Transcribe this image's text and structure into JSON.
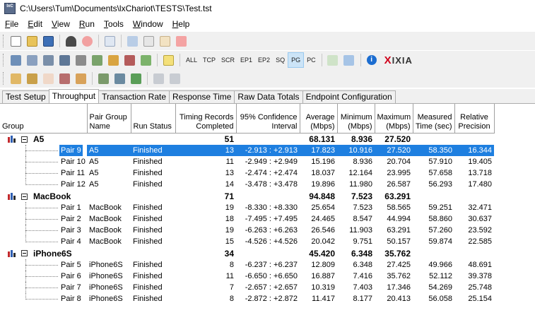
{
  "window": {
    "title": "C:\\Users\\Tum\\Documents\\lxChariot\\TESTS\\Test.tst",
    "icon_text": "IxC"
  },
  "menu": [
    {
      "label": "File",
      "key": "F"
    },
    {
      "label": "Edit",
      "key": "E"
    },
    {
      "label": "View",
      "key": "V"
    },
    {
      "label": "Run",
      "key": "R"
    },
    {
      "label": "Tools",
      "key": "T"
    },
    {
      "label": "Window",
      "key": "W"
    },
    {
      "label": "Help",
      "key": "H"
    }
  ],
  "toolbar2_text": [
    "ALL",
    "TCP",
    "SCR",
    "EP1",
    "EP2",
    "SQ",
    "PG",
    "PC"
  ],
  "toolbar2_active": "PG",
  "brand": {
    "text": "IXIA",
    "x_letter": "X"
  },
  "tabs": [
    "Test Setup",
    "Throughput",
    "Transaction Rate",
    "Response Time",
    "Raw Data Totals",
    "Endpoint Configuration"
  ],
  "active_tab": "Throughput",
  "columns": [
    {
      "label": "Group"
    },
    {
      "label": "Pair Group Name"
    },
    {
      "label": "Run Status"
    },
    {
      "label": "Timing Records Completed"
    },
    {
      "label": "95% Confidence Interval"
    },
    {
      "label": "Average (Mbps)"
    },
    {
      "label": "Minimum (Mbps)"
    },
    {
      "label": "Maximum (Mbps)"
    },
    {
      "label": "Measured Time (sec)"
    },
    {
      "label": "Relative Precision"
    }
  ],
  "groups": [
    {
      "name": "A5",
      "records": "51",
      "average": "68.131",
      "minimum": "8.936",
      "maximum": "27.520",
      "pairs": [
        {
          "pair": "Pair 9",
          "group": "A5",
          "status": "Finished",
          "records": "13",
          "ci": "-2.913 : +2.913",
          "avg": "17.823",
          "min": "10.916",
          "max": "27.520",
          "time": "58.350",
          "rp": "16.344",
          "selected": true
        },
        {
          "pair": "Pair 10",
          "group": "A5",
          "status": "Finished",
          "records": "11",
          "ci": "-2.949 : +2.949",
          "avg": "15.196",
          "min": "8.936",
          "max": "20.704",
          "time": "57.910",
          "rp": "19.405"
        },
        {
          "pair": "Pair 11",
          "group": "A5",
          "status": "Finished",
          "records": "13",
          "ci": "-2.474 : +2.474",
          "avg": "18.037",
          "min": "12.164",
          "max": "23.995",
          "time": "57.658",
          "rp": "13.718"
        },
        {
          "pair": "Pair 12",
          "group": "A5",
          "status": "Finished",
          "records": "14",
          "ci": "-3.478 : +3.478",
          "avg": "19.896",
          "min": "11.980",
          "max": "26.587",
          "time": "56.293",
          "rp": "17.480"
        }
      ]
    },
    {
      "name": "MacBook",
      "records": "71",
      "average": "94.848",
      "minimum": "7.523",
      "maximum": "63.291",
      "pairs": [
        {
          "pair": "Pair 1",
          "group": "MacBook",
          "status": "Finished",
          "records": "19",
          "ci": "-8.330 : +8.330",
          "avg": "25.654",
          "min": "7.523",
          "max": "58.565",
          "time": "59.251",
          "rp": "32.471"
        },
        {
          "pair": "Pair 2",
          "group": "MacBook",
          "status": "Finished",
          "records": "18",
          "ci": "-7.495 : +7.495",
          "avg": "24.465",
          "min": "8.547",
          "max": "44.994",
          "time": "58.860",
          "rp": "30.637"
        },
        {
          "pair": "Pair 3",
          "group": "MacBook",
          "status": "Finished",
          "records": "19",
          "ci": "-6.263 : +6.263",
          "avg": "26.546",
          "min": "11.903",
          "max": "63.291",
          "time": "57.260",
          "rp": "23.592"
        },
        {
          "pair": "Pair 4",
          "group": "MacBook",
          "status": "Finished",
          "records": "15",
          "ci": "-4.526 : +4.526",
          "avg": "20.042",
          "min": "9.751",
          "max": "50.157",
          "time": "59.874",
          "rp": "22.585"
        }
      ]
    },
    {
      "name": "iPhone6S",
      "records": "34",
      "average": "45.420",
      "minimum": "6.348",
      "maximum": "35.762",
      "pairs": [
        {
          "pair": "Pair 5",
          "group": "iPhone6S",
          "status": "Finished",
          "records": "8",
          "ci": "-6.237 : +6.237",
          "avg": "12.809",
          "min": "6.348",
          "max": "27.425",
          "time": "49.966",
          "rp": "48.691"
        },
        {
          "pair": "Pair 6",
          "group": "iPhone6S",
          "status": "Finished",
          "records": "11",
          "ci": "-6.650 : +6.650",
          "avg": "16.887",
          "min": "7.416",
          "max": "35.762",
          "time": "52.112",
          "rp": "39.378"
        },
        {
          "pair": "Pair 7",
          "group": "iPhone6S",
          "status": "Finished",
          "records": "7",
          "ci": "-2.657 : +2.657",
          "avg": "10.319",
          "min": "7.403",
          "max": "17.346",
          "time": "54.269",
          "rp": "25.748"
        },
        {
          "pair": "Pair 8",
          "group": "iPhone6S",
          "status": "Finished",
          "records": "8",
          "ci": "-2.872 : +2.872",
          "avg": "11.417",
          "min": "8.177",
          "max": "20.413",
          "time": "56.058",
          "rp": "25.154"
        }
      ]
    }
  ],
  "colors": {
    "selection": "#1e7fe0",
    "chrome": "#f0f0f0",
    "brand_red": "#d0021b"
  }
}
